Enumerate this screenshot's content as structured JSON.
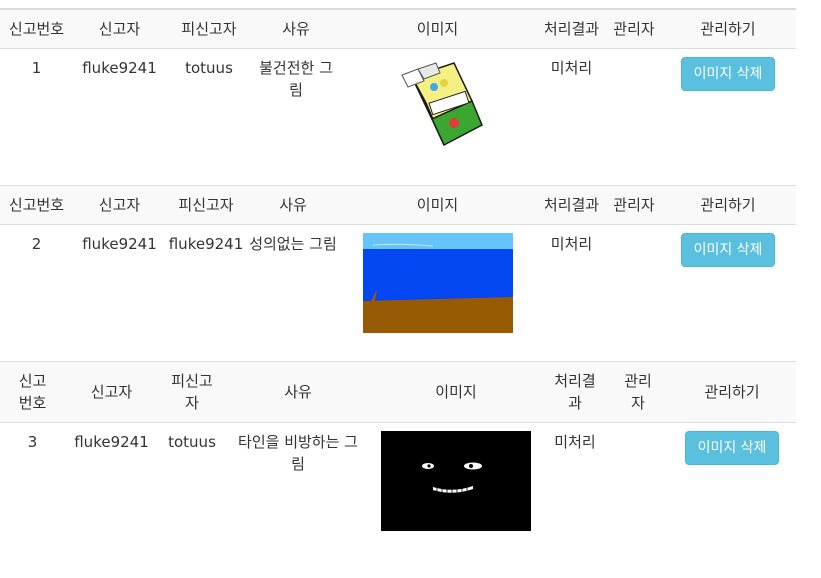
{
  "headers_wide": {
    "report_no": "신고번호",
    "reporter": "신고자",
    "reported": "피신고자",
    "reason": "사유",
    "image": "이미지",
    "result": "처리결과",
    "admin": "관리자",
    "manage": "관리하기"
  },
  "headers_narrow": {
    "report_no": "신고번호",
    "reporter": "신고자",
    "reported": "피신고자",
    "reason": "사유",
    "image": "이미지",
    "result": "처리결과",
    "admin": "관리자",
    "manage": "관리하기"
  },
  "reports": [
    {
      "no": "1",
      "reporter": "fluke9241",
      "reported": "totuus",
      "reason": "불건전한 그림",
      "image_desc": "cigarette-pack-drawing",
      "result": "미처리",
      "admin": "",
      "action": "이미지 삭제"
    },
    {
      "no": "2",
      "reporter": "fluke9241",
      "reported": "fluke9241",
      "reason": "성의없는 그림",
      "image_desc": "sea-and-ground-drawing",
      "result": "미처리",
      "admin": "",
      "action": "이미지 삭제"
    },
    {
      "no": "3",
      "reporter": "fluke9241",
      "reported": "totuus",
      "reason": "타인을 비방하는 그림",
      "image_desc": "dark-grinning-face-drawing",
      "result": "미처리",
      "admin": "",
      "action": "이미지 삭제"
    }
  ],
  "colors": {
    "header_bg": "#f9f9f9",
    "button": "#5bc0de",
    "sky": "#66c4f8",
    "sea": "#0247f2",
    "ground": "#985b05"
  }
}
